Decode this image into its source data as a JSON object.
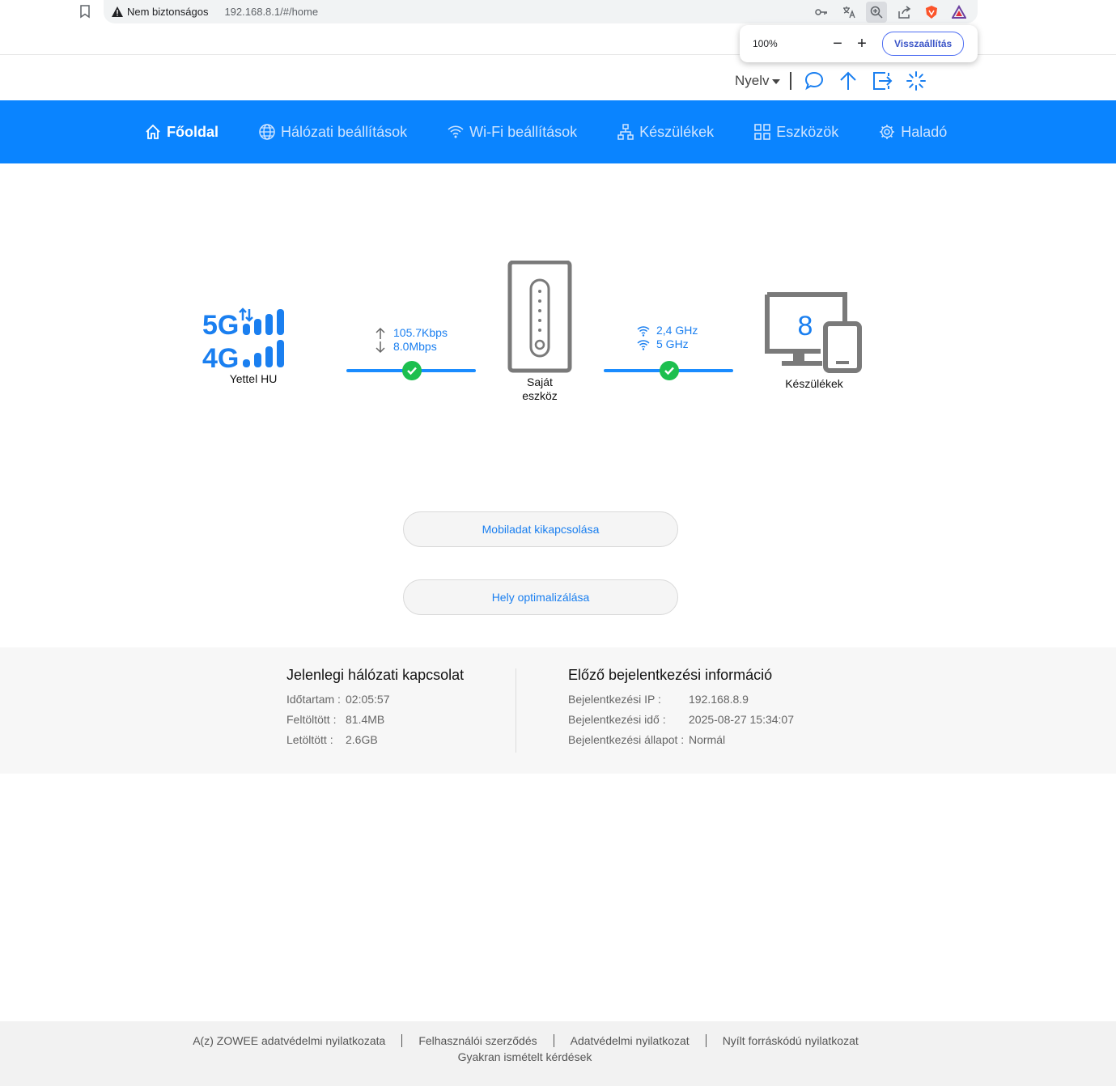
{
  "browser": {
    "security_label": "Nem biztonságos",
    "url": "192.168.8.1/#/home",
    "zoom_percent": "100%",
    "zoom_minus": "−",
    "zoom_plus": "+",
    "zoom_reset_label": "Visszaállítás"
  },
  "header": {
    "language_label": "Nyelv"
  },
  "nav": {
    "items": [
      {
        "label": "Főoldal",
        "icon": "home-icon",
        "active": true
      },
      {
        "label": "Hálózati beállítások",
        "icon": "globe-icon",
        "active": false
      },
      {
        "label": "Wi-Fi beállítások",
        "icon": "wifi-icon",
        "active": false
      },
      {
        "label": "Készülékek",
        "icon": "network-icon",
        "active": false
      },
      {
        "label": "Eszközök",
        "icon": "grid-icon",
        "active": false
      },
      {
        "label": "Haladó",
        "icon": "gear-icon",
        "active": false
      }
    ]
  },
  "topology": {
    "network_badge_top": "5G",
    "network_badge_bottom": "4G",
    "carrier": "Yettel HU",
    "upload_rate": "105.7Kbps",
    "download_rate": "8.0Mbps",
    "router_label_line1": "Saját",
    "router_label_line2": "eszköz",
    "wifi_band_1": "2,4 GHz",
    "wifi_band_2": "5 GHz",
    "device_count": "8",
    "devices_label": "Készülékek"
  },
  "actions": {
    "mobile_data_off": "Mobiladat kikapcsolása",
    "location_optimize": "Hely optimalizálása"
  },
  "current_connection": {
    "title": "Jelenlegi hálózati kapcsolat",
    "rows": [
      {
        "label": "Időtartam :",
        "value": "02:05:57"
      },
      {
        "label": "Feltöltött :",
        "value": "81.4MB"
      },
      {
        "label": "Letöltött :",
        "value": "2.6GB"
      }
    ]
  },
  "previous_login": {
    "title": "Előző bejelentkezési információ",
    "rows": [
      {
        "label": "Bejelentkezési IP :",
        "value": "192.168.8.9"
      },
      {
        "label": "Bejelentkezési idő :",
        "value": "2025-08-27 15:34:07"
      },
      {
        "label": "Bejelentkezési állapot :",
        "value": "Normál"
      }
    ]
  },
  "footer": {
    "links": [
      "A(z) ZOWEE adatvédelmi nyilatkozata",
      "Felhasználói szerződés",
      "Adatvédelmi nyilatkozat",
      "Nyílt forráskódú nyilatkozat"
    ],
    "faq": "Gyakran ismételt kérdések"
  },
  "colors": {
    "brand_blue": "#0a84ff",
    "ok_green": "#1dbf4f",
    "icon_gray": "#7a7a7a"
  }
}
